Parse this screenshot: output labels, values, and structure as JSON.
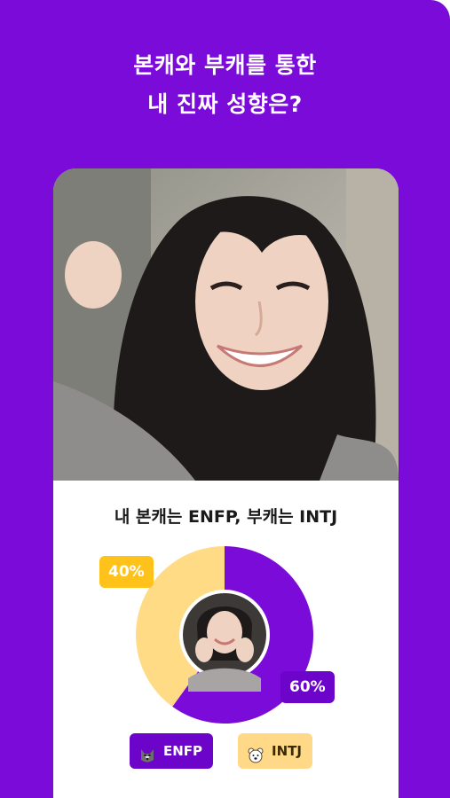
{
  "headline": {
    "line1": "본캐와 부캐를 통한",
    "line2": "내 진짜 성향은?"
  },
  "result": {
    "caption": "내 본캐는 ENFP, 부캐는 INTJ",
    "chart_data": {
      "type": "pie",
      "categories": [
        "ENFP",
        "INTJ"
      ],
      "values": [
        60,
        40
      ],
      "data_labels": [
        "60%",
        "40%"
      ],
      "colors": [
        "#7a0bd9",
        "#ffdb86"
      ]
    },
    "legend": [
      {
        "label": "ENFP",
        "icon": "husky-icon",
        "color": "#6c04c9"
      },
      {
        "label": "INTJ",
        "icon": "bear-icon",
        "color": "#ffd888"
      }
    ]
  }
}
